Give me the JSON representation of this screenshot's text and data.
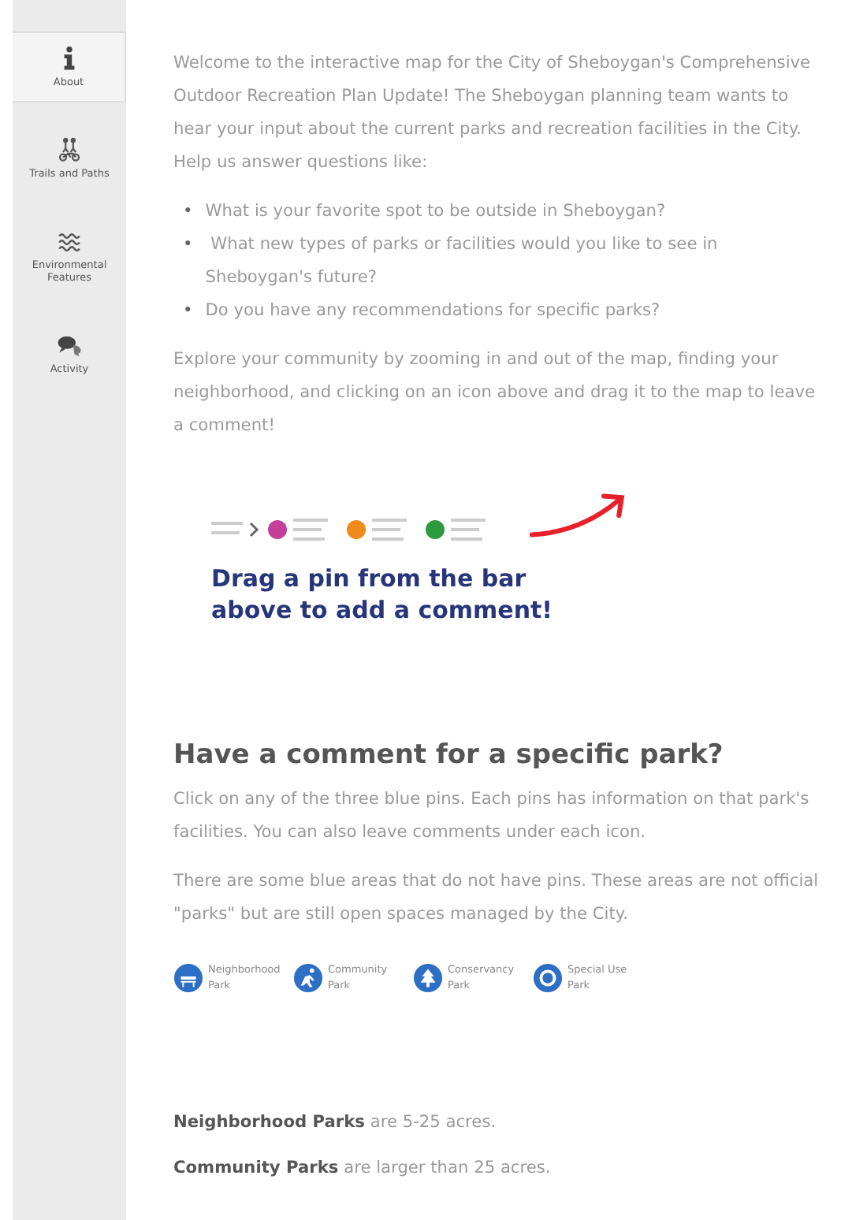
{
  "sidebar": {
    "items": [
      {
        "label": "About",
        "kind": "info",
        "selected": true
      },
      {
        "label": "Trails and Paths",
        "kind": "trails",
        "selected": false
      },
      {
        "label": "Environmental Features",
        "kind": "water",
        "selected": false
      },
      {
        "label": "Activity",
        "kind": "chat",
        "selected": false
      }
    ]
  },
  "intro": "Welcome to the interactive map for the City of Sheboygan's Comprehensive Outdoor Recreation Plan Update! The Sheboygan planning team wants to hear your input about the current parks and recreation facilities in the City. Help us answer questions like:",
  "questions": [
    {
      "bullet": "•",
      "text": "What is your favorite spot to be outside in Sheboygan?"
    },
    {
      "bullet": "•",
      "text": " What new types of parks or facilities would you like to see in Sheboygan's future?"
    },
    {
      "bullet": "•",
      "text": "Do you have any recommendations for specific parks?"
    }
  ],
  "explore": "Explore your community by zooming in and out of the map, finding your neighborhood, and clicking on an icon above and drag it to the map to leave a comment!",
  "hint": {
    "text": "Drag a pin from the bar above to add a comment!",
    "pins": [
      {
        "color": "#c2409a"
      },
      {
        "color": "#f08a1c"
      },
      {
        "color": "#2e9a3e"
      }
    ]
  },
  "park_section": {
    "heading": "Have a comment for a specific park?",
    "paragraphs": [
      "Click on any of the three blue pins. Each pins has information on that park's facilities. You can also leave comments under each icon.",
      "There are some blue areas that do not have pins. These areas are not official \"parks\" but are still open spaces managed by the City."
    ],
    "legend": [
      {
        "label": "Neighborhood Park",
        "kind": "bench"
      },
      {
        "label": "Community Park",
        "kind": "play"
      },
      {
        "label": "Conservancy Park",
        "kind": "tree"
      },
      {
        "label": "Special Use Park",
        "kind": "ring"
      }
    ],
    "definitions": [
      "**Neighborhood Parks** are 5-25 acres.",
      "**Community Parks** are larger than 25 acres."
    ]
  }
}
